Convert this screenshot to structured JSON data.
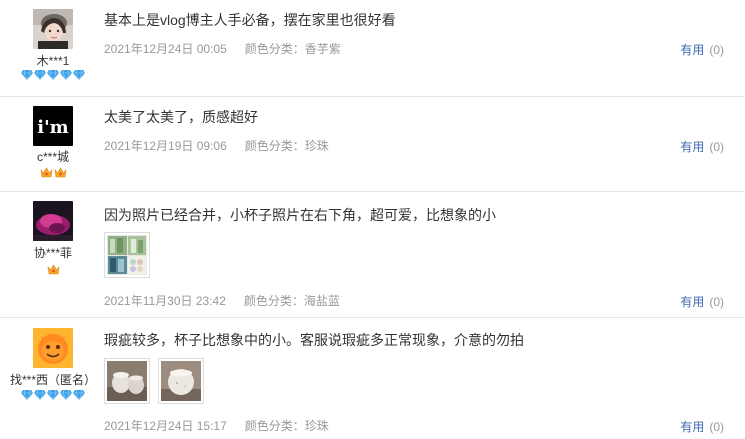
{
  "reviews": [
    {
      "username": "木***1",
      "avatar_style": "photo-woman",
      "badge_type": "diamond",
      "badge_count": 5,
      "content": "基本上是vlog博主人手必备，摆在家里也很好看",
      "date": "2021年12月24日 00:05",
      "color_label": "颜色分类：",
      "color_value": "香芋紫",
      "useful_label": "有用",
      "useful_count": "(0)",
      "images": []
    },
    {
      "username": "c***城",
      "avatar_style": "im-text",
      "avatar_text": "i'm",
      "badge_type": "crown",
      "badge_count": 2,
      "content": "太美了太美了，质感超好",
      "date": "2021年12月19日 09:06",
      "color_label": "颜色分类：",
      "color_value": "珍珠",
      "useful_label": "有用",
      "useful_count": "(0)",
      "images": []
    },
    {
      "username": "协***菲",
      "avatar_style": "photo-pink",
      "badge_type": "crown",
      "badge_count": 1,
      "content": "因为照片已经合并，小杯子照片在右下角，超可爱，比想象的小",
      "date": "2021年11月30日 23:42",
      "color_label": "颜色分类：",
      "color_value": "海盐蓝",
      "useful_label": "有用",
      "useful_count": "(0)",
      "images": [
        "collage-cups"
      ]
    },
    {
      "username": "找***西（匿名）",
      "avatar_style": "orange-mascot",
      "badge_type": "diamond",
      "badge_count": 5,
      "content": "瑕疵较多，杯子比想象中的小。客服说瑕疵多正常现象，介意的勿拍",
      "date": "2021年12月24日 15:17",
      "color_label": "颜色分类：",
      "color_value": "珍珠",
      "useful_label": "有用",
      "useful_count": "(0)",
      "images": [
        "pearl-cups-1",
        "pearl-cups-2"
      ]
    }
  ],
  "colors": {
    "link": "#3f69b1",
    "meta": "#999999",
    "diamond": "#3aa0ea",
    "crown": "#f5a623"
  }
}
